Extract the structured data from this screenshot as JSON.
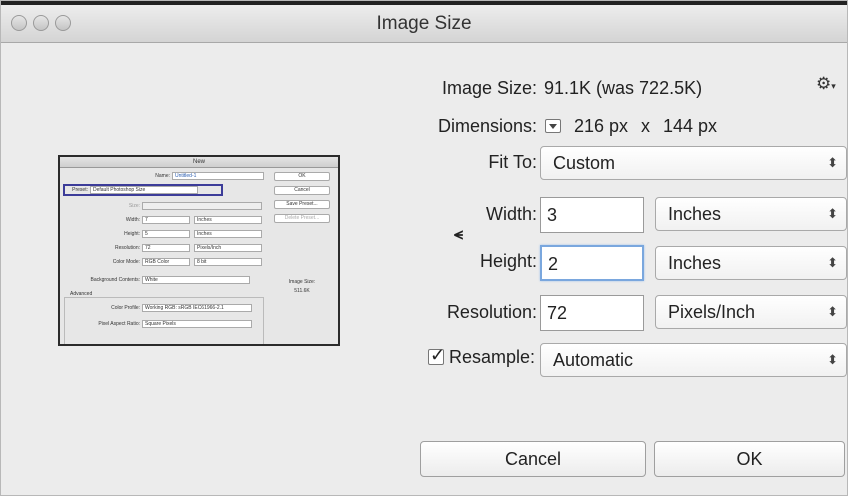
{
  "window": {
    "title": "Image Size"
  },
  "info": {
    "image_size_label": "Image Size:",
    "image_size_value": "91.1K (was 722.5K)",
    "dimensions_label": "Dimensions:",
    "dimensions_width": "216 px",
    "dimensions_x": "x",
    "dimensions_height": "144 px"
  },
  "fit_to": {
    "label": "Fit To:",
    "value": "Custom"
  },
  "width": {
    "label": "Width:",
    "value": "3",
    "unit": "Inches"
  },
  "height": {
    "label": "Height:",
    "value": "2",
    "unit": "Inches"
  },
  "resolution": {
    "label": "Resolution:",
    "value": "72",
    "unit": "Pixels/Inch"
  },
  "resample": {
    "label": "Resample:",
    "value": "Automatic",
    "checked": true
  },
  "buttons": {
    "cancel": "Cancel",
    "ok": "OK"
  },
  "thumbnail": {
    "title": "New",
    "name_label": "Name:",
    "name_value": "Untitled-1",
    "preset_label": "Preset:",
    "preset_value": "Default Photoshop Size",
    "size_label": "Size:",
    "width_label": "Width:",
    "width_value": "7",
    "width_unit": "Inches",
    "height_label": "Height:",
    "height_value": "5",
    "height_unit": "Inches",
    "resolution_label": "Resolution:",
    "resolution_value": "72",
    "resolution_unit": "Pixels/Inch",
    "color_mode_label": "Color Mode:",
    "color_mode_value": "RGB Color",
    "color_mode_bits": "8 bit",
    "bg_label": "Background Contents:",
    "bg_value": "White",
    "advanced_label": "Advanced",
    "color_profile_label": "Color Profile:",
    "color_profile_value": "Working RGB: sRGB IEC61966-2.1",
    "pixel_aspect_label": "Pixel Aspect Ratio:",
    "pixel_aspect_value": "Square Pixels",
    "ok": "OK",
    "cancel": "Cancel",
    "save_preset": "Save Preset...",
    "delete_preset": "Delete Preset...",
    "image_size_label": "Image Size:",
    "image_size_value": "511.6K"
  },
  "icons": {
    "gear": "gear-icon",
    "link": "chain-link-icon"
  }
}
